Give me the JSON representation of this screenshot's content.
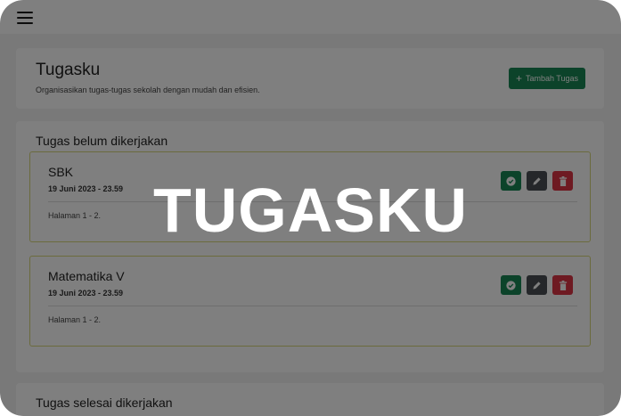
{
  "header": {
    "title": "Tugasku",
    "subtitle": "Organisasikan tugas-tugas sekolah dengan mudah dan efisien.",
    "add_button_label": "Tambah Tugas",
    "add_button_icon": "plus-icon"
  },
  "sections": {
    "pending_title": "Tugas belum dikerjakan",
    "done_title": "Tugas selesai dikerjakan"
  },
  "tasks": [
    {
      "name": "SBK",
      "deadline": "19 Juni 2023 - 23.59",
      "note": "Halaman 1 - 2."
    },
    {
      "name": "Matematika V",
      "deadline": "19 Juni 2023 - 23.59",
      "note": "Halaman 1 - 2."
    }
  ],
  "overlay": {
    "text": "TUGASKU"
  },
  "colors": {
    "primary_green": "#198754",
    "edit_gray": "#4a4f55",
    "delete_red": "#dc3545",
    "task_border": "#d7d77a"
  }
}
